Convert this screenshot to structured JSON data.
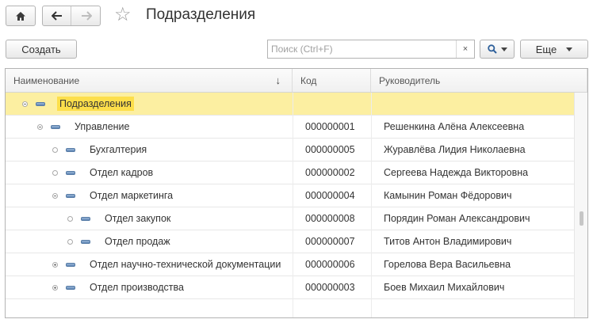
{
  "window": {
    "title": "Подразделения",
    "home_icon": "home-icon",
    "back_icon": "arrow-left-icon",
    "forward_icon": "arrow-right-icon",
    "favorite_icon": "star-icon"
  },
  "toolbar": {
    "create_label": "Создать",
    "search_placeholder": "Поиск (Ctrl+F)",
    "search_value": "",
    "clear_label": "×",
    "more_label": "Еще"
  },
  "table": {
    "columns": {
      "name": "Наименование",
      "sort_indicator": "↓",
      "code": "Код",
      "head": "Руководитель"
    },
    "rows": [
      {
        "name": "Подразделения",
        "code": "",
        "head": "",
        "level": 0,
        "toggle": "minus",
        "selected": true
      },
      {
        "name": "Управление",
        "code": "000000001",
        "head": "Решенкина Алёна Алексеевна",
        "level": 1,
        "toggle": "minus"
      },
      {
        "name": "Бухгалтерия",
        "code": "000000005",
        "head": "Журавлёва Лидия Николаевна",
        "level": 2,
        "toggle": "none"
      },
      {
        "name": "Отдел кадров",
        "code": "000000002",
        "head": "Сергеева Надежда Викторовна",
        "level": 2,
        "toggle": "none"
      },
      {
        "name": "Отдел маркетинга",
        "code": "000000004",
        "head": "Камынин Роман Фёдорович",
        "level": 2,
        "toggle": "minus"
      },
      {
        "name": "Отдел закупок",
        "code": "000000008",
        "head": "Порядин Роман Александрович",
        "level": 3,
        "toggle": "none"
      },
      {
        "name": "Отдел продаж",
        "code": "000000007",
        "head": "Титов Антон Владимирович",
        "level": 3,
        "toggle": "none"
      },
      {
        "name": "Отдел научно-технической документации",
        "code": "000000006",
        "head": "Горелова Вера Васильевна",
        "level": 2,
        "toggle": "plus"
      },
      {
        "name": "Отдел производства",
        "code": "000000003",
        "head": "Боев Михаил Михайлович",
        "level": 2,
        "toggle": "plus"
      }
    ]
  },
  "colors": {
    "selected_row": "#fcefa1",
    "selected_name_highlight": "#fddf4b",
    "group_icon": "#5f86b5"
  }
}
